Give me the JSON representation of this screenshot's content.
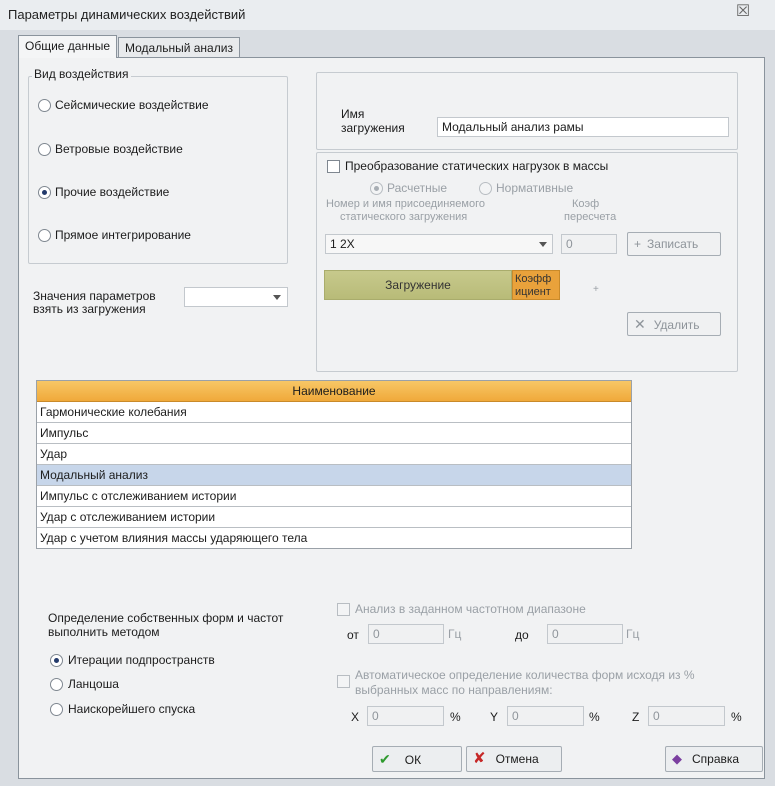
{
  "window": {
    "title": "Параметры динамических воздействий",
    "close_glyph": "☒"
  },
  "tabs": [
    {
      "label": "Общие данные",
      "active": true
    },
    {
      "label": "Модальный анализ",
      "active": false
    }
  ],
  "impact": {
    "group_label": "Вид воздействия",
    "options": [
      {
        "label": "Сейсмические воздействие",
        "checked": false
      },
      {
        "label": "Ветровые воздействие",
        "checked": false
      },
      {
        "label": "Прочие воздействие",
        "checked": true
      },
      {
        "label": "Прямое интегрирование",
        "checked": false
      }
    ]
  },
  "load_name": {
    "label_line1": "Имя",
    "label_line2": "загружения",
    "value": "Модальный анализ рамы"
  },
  "params_from": {
    "label_line1": "Значения параметров",
    "label_line2": "взять из загружения",
    "value": ""
  },
  "static_conv": {
    "checkbox_label": "Преобразование статических нагрузок в массы",
    "radio_calc": "Расчетные",
    "radio_norm": "Нормативные",
    "col_name_line1": "Номер и имя присоединяемого",
    "col_name_line2": "статического загружения",
    "col_coef_line1": "Коэф",
    "col_coef_line2": "пересчета",
    "combo_value": "1 2X",
    "coef_value": "0",
    "write_btn": "Записать",
    "write_glyph": "+",
    "table_hdr_load": "Загружение",
    "table_hdr_coef_line1": "Коэфф",
    "table_hdr_coef_line2": "ициент",
    "plus_mark": "+",
    "delete_btn": "Удалить",
    "delete_glyph": "✕"
  },
  "types_table": {
    "header": "Наименование",
    "rows": [
      "Гармонические колебания",
      "Импульс",
      "Удар",
      "Модальный анализ",
      "Импульс с отслеживанием истории",
      "Удар с отслеживанием истории",
      "Удар с учетом влияния массы ударяющего тела"
    ],
    "selected_index": 3
  },
  "method": {
    "label_line1": "Определение собственных форм и частот",
    "label_line2": "выполнить методом",
    "options": [
      {
        "label": "Итерации подпространств",
        "checked": true
      },
      {
        "label": "Ланцоша",
        "checked": false
      },
      {
        "label": "Наискорейшего спуска",
        "checked": false
      }
    ]
  },
  "freq_range": {
    "checkbox_label": "Анализ в заданном частотном диапазоне",
    "from_label": "от",
    "from_value": "0",
    "from_unit": "Гц",
    "to_label": "до",
    "to_value": "0",
    "to_unit": "Гц"
  },
  "auto_forms": {
    "checkbox_label_line1": "Автоматическое определение количества форм исходя из %",
    "checkbox_label_line2": "выбранных масс по направлениям:",
    "x_label": "X",
    "x_value": "0",
    "y_label": "Y",
    "y_value": "0",
    "z_label": "Z",
    "z_value": "0",
    "unit": "%"
  },
  "footer": {
    "ok": "ОК",
    "ok_glyph": "✔",
    "cancel": "Отмена",
    "cancel_glyph": "✘",
    "help": "Справка",
    "help_glyph": "◆"
  }
}
